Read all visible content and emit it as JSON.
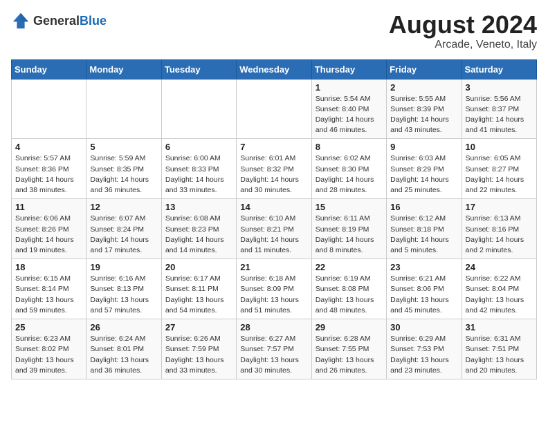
{
  "header": {
    "logo_general": "General",
    "logo_blue": "Blue",
    "title": "August 2024",
    "subtitle": "Arcade, Veneto, Italy"
  },
  "weekdays": [
    "Sunday",
    "Monday",
    "Tuesday",
    "Wednesday",
    "Thursday",
    "Friday",
    "Saturday"
  ],
  "weeks": [
    [
      {
        "day": "",
        "info": ""
      },
      {
        "day": "",
        "info": ""
      },
      {
        "day": "",
        "info": ""
      },
      {
        "day": "",
        "info": ""
      },
      {
        "day": "1",
        "info": "Sunrise: 5:54 AM\nSunset: 8:40 PM\nDaylight: 14 hours\nand 46 minutes."
      },
      {
        "day": "2",
        "info": "Sunrise: 5:55 AM\nSunset: 8:39 PM\nDaylight: 14 hours\nand 43 minutes."
      },
      {
        "day": "3",
        "info": "Sunrise: 5:56 AM\nSunset: 8:37 PM\nDaylight: 14 hours\nand 41 minutes."
      }
    ],
    [
      {
        "day": "4",
        "info": "Sunrise: 5:57 AM\nSunset: 8:36 PM\nDaylight: 14 hours\nand 38 minutes."
      },
      {
        "day": "5",
        "info": "Sunrise: 5:59 AM\nSunset: 8:35 PM\nDaylight: 14 hours\nand 36 minutes."
      },
      {
        "day": "6",
        "info": "Sunrise: 6:00 AM\nSunset: 8:33 PM\nDaylight: 14 hours\nand 33 minutes."
      },
      {
        "day": "7",
        "info": "Sunrise: 6:01 AM\nSunset: 8:32 PM\nDaylight: 14 hours\nand 30 minutes."
      },
      {
        "day": "8",
        "info": "Sunrise: 6:02 AM\nSunset: 8:30 PM\nDaylight: 14 hours\nand 28 minutes."
      },
      {
        "day": "9",
        "info": "Sunrise: 6:03 AM\nSunset: 8:29 PM\nDaylight: 14 hours\nand 25 minutes."
      },
      {
        "day": "10",
        "info": "Sunrise: 6:05 AM\nSunset: 8:27 PM\nDaylight: 14 hours\nand 22 minutes."
      }
    ],
    [
      {
        "day": "11",
        "info": "Sunrise: 6:06 AM\nSunset: 8:26 PM\nDaylight: 14 hours\nand 19 minutes."
      },
      {
        "day": "12",
        "info": "Sunrise: 6:07 AM\nSunset: 8:24 PM\nDaylight: 14 hours\nand 17 minutes."
      },
      {
        "day": "13",
        "info": "Sunrise: 6:08 AM\nSunset: 8:23 PM\nDaylight: 14 hours\nand 14 minutes."
      },
      {
        "day": "14",
        "info": "Sunrise: 6:10 AM\nSunset: 8:21 PM\nDaylight: 14 hours\nand 11 minutes."
      },
      {
        "day": "15",
        "info": "Sunrise: 6:11 AM\nSunset: 8:19 PM\nDaylight: 14 hours\nand 8 minutes."
      },
      {
        "day": "16",
        "info": "Sunrise: 6:12 AM\nSunset: 8:18 PM\nDaylight: 14 hours\nand 5 minutes."
      },
      {
        "day": "17",
        "info": "Sunrise: 6:13 AM\nSunset: 8:16 PM\nDaylight: 14 hours\nand 2 minutes."
      }
    ],
    [
      {
        "day": "18",
        "info": "Sunrise: 6:15 AM\nSunset: 8:14 PM\nDaylight: 13 hours\nand 59 minutes."
      },
      {
        "day": "19",
        "info": "Sunrise: 6:16 AM\nSunset: 8:13 PM\nDaylight: 13 hours\nand 57 minutes."
      },
      {
        "day": "20",
        "info": "Sunrise: 6:17 AM\nSunset: 8:11 PM\nDaylight: 13 hours\nand 54 minutes."
      },
      {
        "day": "21",
        "info": "Sunrise: 6:18 AM\nSunset: 8:09 PM\nDaylight: 13 hours\nand 51 minutes."
      },
      {
        "day": "22",
        "info": "Sunrise: 6:19 AM\nSunset: 8:08 PM\nDaylight: 13 hours\nand 48 minutes."
      },
      {
        "day": "23",
        "info": "Sunrise: 6:21 AM\nSunset: 8:06 PM\nDaylight: 13 hours\nand 45 minutes."
      },
      {
        "day": "24",
        "info": "Sunrise: 6:22 AM\nSunset: 8:04 PM\nDaylight: 13 hours\nand 42 minutes."
      }
    ],
    [
      {
        "day": "25",
        "info": "Sunrise: 6:23 AM\nSunset: 8:02 PM\nDaylight: 13 hours\nand 39 minutes."
      },
      {
        "day": "26",
        "info": "Sunrise: 6:24 AM\nSunset: 8:01 PM\nDaylight: 13 hours\nand 36 minutes."
      },
      {
        "day": "27",
        "info": "Sunrise: 6:26 AM\nSunset: 7:59 PM\nDaylight: 13 hours\nand 33 minutes."
      },
      {
        "day": "28",
        "info": "Sunrise: 6:27 AM\nSunset: 7:57 PM\nDaylight: 13 hours\nand 30 minutes."
      },
      {
        "day": "29",
        "info": "Sunrise: 6:28 AM\nSunset: 7:55 PM\nDaylight: 13 hours\nand 26 minutes."
      },
      {
        "day": "30",
        "info": "Sunrise: 6:29 AM\nSunset: 7:53 PM\nDaylight: 13 hours\nand 23 minutes."
      },
      {
        "day": "31",
        "info": "Sunrise: 6:31 AM\nSunset: 7:51 PM\nDaylight: 13 hours\nand 20 minutes."
      }
    ]
  ]
}
